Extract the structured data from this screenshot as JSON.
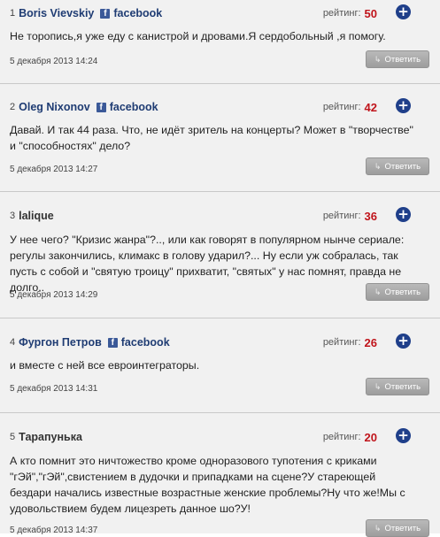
{
  "rating_label": "рейтинг:",
  "reply_label": "Ответить",
  "facebook_label": "facebook",
  "colors": {
    "author": "#1f3c73",
    "rating_value": "#c0141b",
    "plus_button": "#1f3f8a",
    "facebook": "#3b5998",
    "reply_button": "#a9a9a9"
  },
  "comments": [
    {
      "num": "1",
      "author": "Boris Vievskiy",
      "facebook": true,
      "rating": "50",
      "text": "Не торопись,я уже еду с канистрой и дровами.Я сердобольный ,я помогу.",
      "date": "5 декабря 2013 14:24"
    },
    {
      "num": "2",
      "author": "Oleg Nixonov",
      "facebook": true,
      "rating": "42",
      "text": "Давай. И так 44 раза. Что, не идёт зритель на концерты? Может в \"творчестве\" и \"способностях\" дело?",
      "date": "5 декабря 2013 14:27"
    },
    {
      "num": "3",
      "author": "lalique",
      "facebook": false,
      "rating": "36",
      "text": "У нее чего? \"Кризис жанра\"?.., или как говорят в популярном нынче сериале: регулы закончились, климакс в голову ударил?... Ну если уж собралась, так пусть с собой и \"святую троицу\" прихватит, \"святых\" у нас помнят, правда не долго..",
      "date": "5 декабря 2013 14:29"
    },
    {
      "num": "4",
      "author": "Фургон Петров",
      "facebook": true,
      "rating": "26",
      "text": "и вместе с ней все евроинтеграторы.",
      "date": "5 декабря 2013 14:31"
    },
    {
      "num": "5",
      "author": "Тарапунька",
      "facebook": false,
      "rating": "20",
      "text": "А кто помнит это ничтожество кроме одноразового тупотения с криками \"гЭй\",\"гЭй\",свистением в дудочки и припадками на сцене?У стареющей бездари начались известные возрастные женские проблемы?Ну что же!Мы с удовольствием будем лицезреть данное шо?У!",
      "date": "5 декабря 2013 14:37"
    }
  ]
}
